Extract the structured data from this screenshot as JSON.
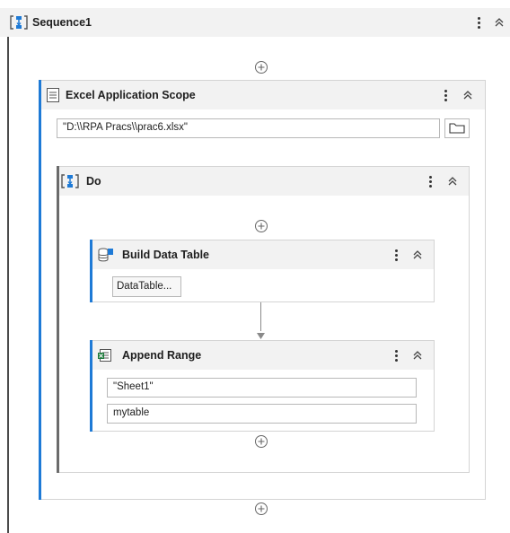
{
  "sequence": {
    "title": "Sequence1"
  },
  "excel_scope": {
    "title": "Excel Application Scope",
    "workbook_path": "\"D:\\\\RPA Pracs\\\\prac6.xlsx\""
  },
  "do_block": {
    "title": "Do"
  },
  "build_data_table": {
    "title": "Build Data Table",
    "button_label": "DataTable..."
  },
  "append_range": {
    "title": "Append Range",
    "sheet_name": "\"Sheet1\"",
    "data_table": "mytable"
  },
  "icons": {
    "sequence": "sequence-icon",
    "excel_scope": "excel-scope-icon",
    "build_data_table": "data-table-icon",
    "append_range": "excel-append-icon",
    "menu": "more-vertical-icon",
    "collapse": "chevron-double-up-icon",
    "add": "add-activity-icon",
    "folder": "folder-icon"
  },
  "colors": {
    "accent_blue": "#1e7ad6",
    "header_bg": "#f2f2f2",
    "dark_rail": "#6b6b6b"
  }
}
